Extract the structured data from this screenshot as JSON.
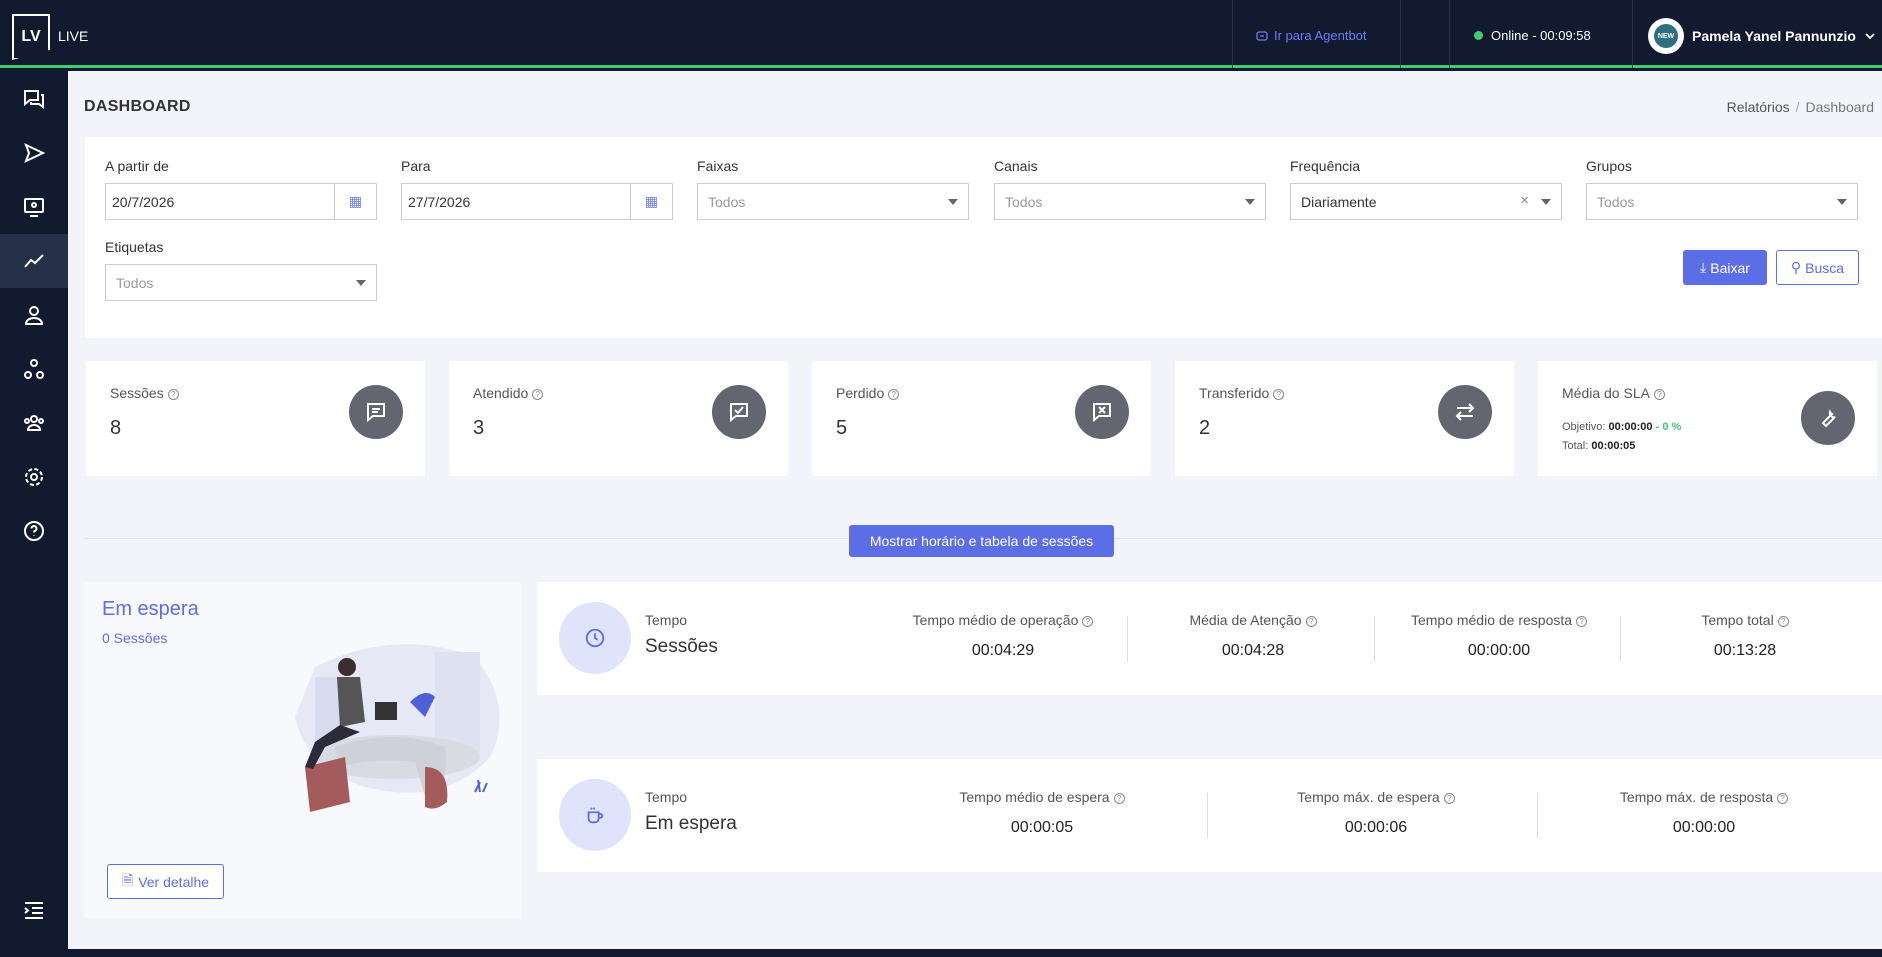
{
  "topbar": {
    "logo": "LV",
    "app_name": "LIVE",
    "agentbot_link": "Ir para Agentbot",
    "status": "Online - 00:09:58",
    "user_name": "Pamela Yanel Pannunzio",
    "avatar_text": "NEW"
  },
  "sidebar": {
    "items": [
      "chat-icon",
      "send-icon",
      "monitor-icon",
      "chart-line-icon",
      "user-icon",
      "network-icon",
      "team-icon",
      "settings-icon",
      "help-icon"
    ],
    "active": "chart-line-icon",
    "collapse_icon": "collapse-menu-icon"
  },
  "page": {
    "title": "DASHBOARD",
    "breadcrumb": [
      "Relatórios",
      "Dashboard"
    ]
  },
  "filters": {
    "from_label": "A partir de",
    "from_value": "20/7/2026",
    "to_label": "Para",
    "to_value": "27/7/2026",
    "bands_label": "Faixas",
    "bands_value": "Todos",
    "channels_label": "Canais",
    "channels_value": "Todos",
    "frequency_label": "Frequência",
    "frequency_value": "Diariamente",
    "groups_label": "Grupos",
    "groups_value": "Todos",
    "tags_label": "Etiquetas",
    "tags_value": "Todos",
    "download_label": "Baixar",
    "search_label": "Busca"
  },
  "cards": {
    "sessions": {
      "label": "Sessões",
      "value": "8"
    },
    "attended": {
      "label": "Atendido",
      "value": "3"
    },
    "lost": {
      "label": "Perdido",
      "value": "5"
    },
    "transferred": {
      "label": "Transferido",
      "value": "2"
    },
    "sla": {
      "label": "Média do SLA",
      "objective_label": "Objetivo:",
      "objective_value": "00:00:00",
      "objective_pct": "- 0 %",
      "total_label": "Total:",
      "total_value": "00:00:05"
    }
  },
  "show_button": "Mostrar horário e tabela de sessões",
  "waiting": {
    "title": "Em espera",
    "sessions": "0 Sessões",
    "detail_button": "Ver detalhe"
  },
  "sessions_panel": {
    "small": "Tempo",
    "big": "Sessões",
    "metrics": [
      {
        "label": "Tempo médio de operação",
        "value": "00:04:29"
      },
      {
        "label": "Média de Atenção",
        "value": "00:04:28"
      },
      {
        "label": "Tempo médio de resposta",
        "value": "00:00:00"
      },
      {
        "label": "Tempo total",
        "value": "00:13:28"
      }
    ]
  },
  "waiting_panel": {
    "small": "Tempo",
    "big": "Em espera",
    "metrics": [
      {
        "label": "Tempo médio de espera",
        "value": "00:00:05"
      },
      {
        "label": "Tempo máx. de espera",
        "value": "00:00:06"
      },
      {
        "label": "Tempo máx. de resposta",
        "value": "00:00:00"
      }
    ]
  }
}
